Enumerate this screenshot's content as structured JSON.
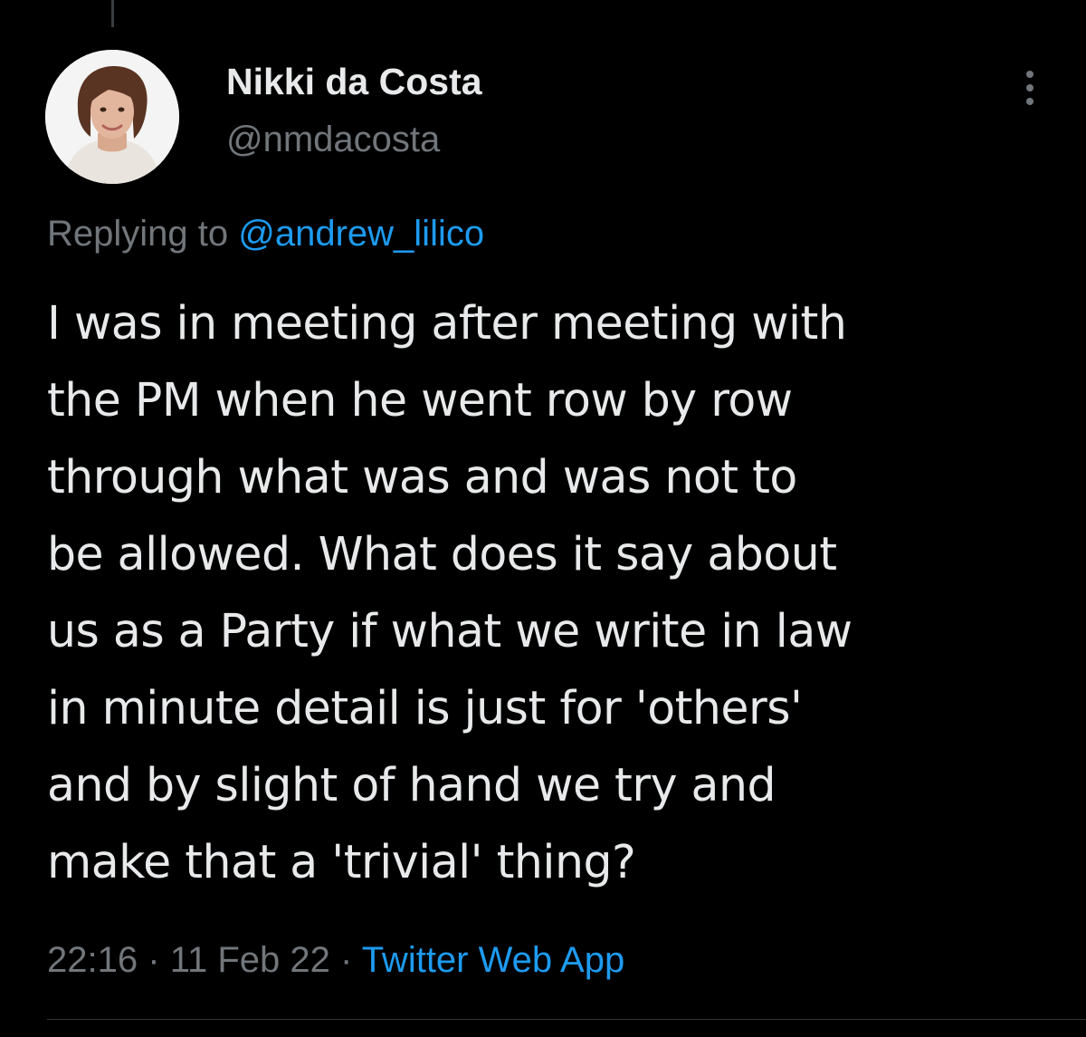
{
  "tweet": {
    "author": {
      "display_name": "Nikki da Costa",
      "handle": "@nmdacosta"
    },
    "replying_to_prefix": "Replying to",
    "replying_to_handle": "@andrew_lilico",
    "text_lines": [
      "I was in meeting after meeting with",
      "the PM when he went row by row",
      "through what was and was not to",
      "be allowed. What does it say about",
      "us as a Party if what we write in law",
      "in minute detail is just for 'others'",
      "and by slight of hand we try and",
      "make that a 'trivial' thing?"
    ],
    "time": "22:16",
    "date": "11 Feb 22",
    "separator": "·",
    "source": "Twitter Web App"
  },
  "icons": {
    "more": "more-vertical-icon",
    "avatar": "avatar"
  },
  "colors": {
    "background": "#000000",
    "primary_text": "#e7e9ea",
    "secondary_text": "#71767b",
    "accent": "#1d9bf0",
    "divider": "#2f3336"
  }
}
